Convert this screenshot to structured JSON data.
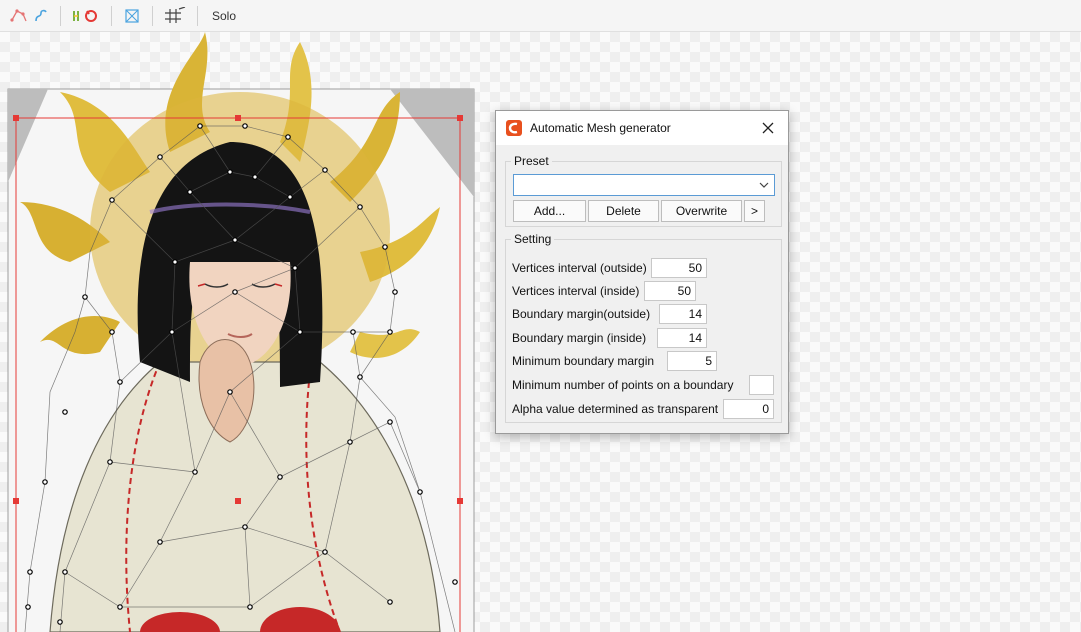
{
  "toolbar": {
    "solo_label": "Solo",
    "icons": [
      "mesh-edit-icon",
      "mesh-link-icon",
      "mesh-reset-icon",
      "mesh-select-icon",
      "grid-icon"
    ]
  },
  "dialog": {
    "title": "Automatic Mesh generator",
    "preset": {
      "group_label": "Preset",
      "selected_value": "",
      "buttons": {
        "add": "Add...",
        "delete": "Delete",
        "overwrite": "Overwrite",
        "more": ">"
      }
    },
    "setting": {
      "group_label": "Setting",
      "fields": [
        {
          "label": "Vertices interval (outside)",
          "value": "50"
        },
        {
          "label": "Vertices interval (inside)",
          "value": "50"
        },
        {
          "label": "Boundary margin(outside)",
          "value": "14"
        },
        {
          "label": "Boundary margin (inside)",
          "value": "14"
        },
        {
          "label": "Minimum boundary margin",
          "value": "5"
        },
        {
          "label": "Minimum number of points on a boundary",
          "value": ""
        },
        {
          "label": "Alpha value determined as transparent",
          "value": "0"
        }
      ]
    }
  },
  "colors": {
    "accent": "#5b9bd5",
    "app_icon": "#e8501e",
    "selection": "#e53935",
    "dialog_bg": "#f0f0f0"
  }
}
